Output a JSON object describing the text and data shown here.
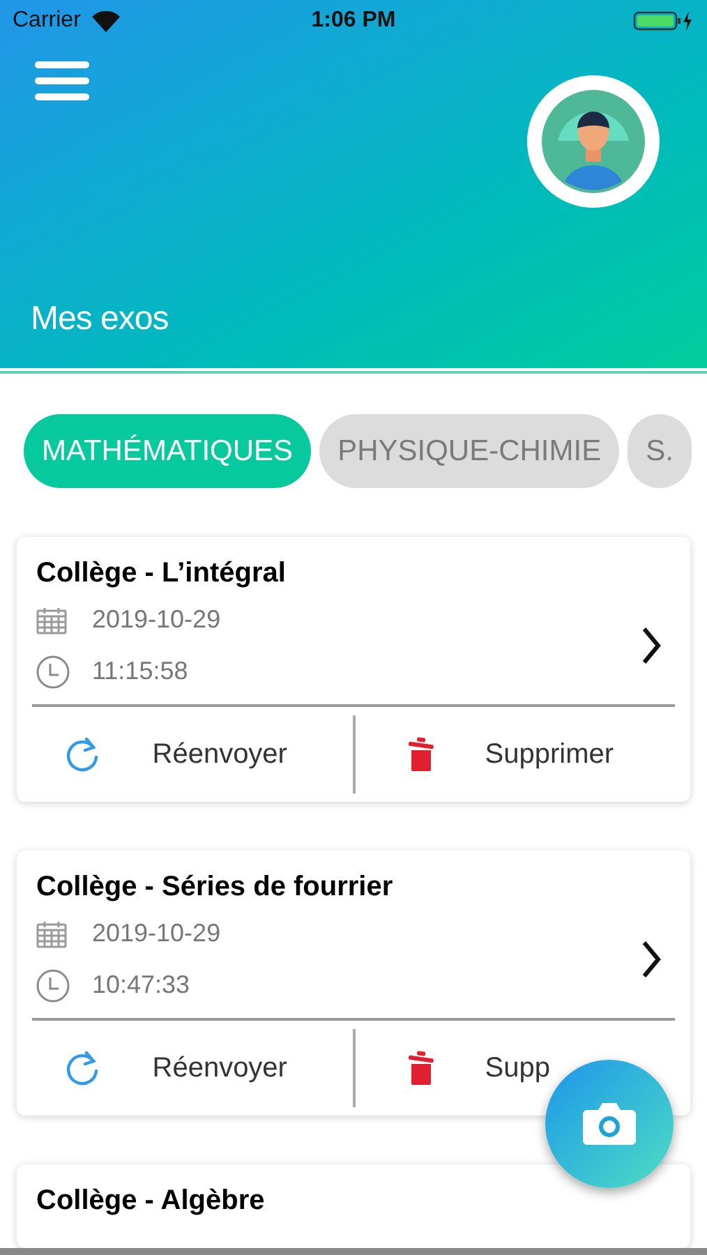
{
  "status_bar": {
    "carrier": "Carrier",
    "time": "1:06 PM"
  },
  "header": {
    "title": "Mes exos"
  },
  "tabs": [
    {
      "label": "MATHÉMATIQUES",
      "selected": true
    },
    {
      "label": "PHYSIQUE-CHIMIE",
      "selected": false
    },
    {
      "label": "S.",
      "selected": false
    }
  ],
  "cards": [
    {
      "title": "Collège - L’intégral",
      "date": "2019-10-29",
      "time": "11:15:58",
      "actions": [
        {
          "kind": "resend",
          "label": "Réenvoyer"
        },
        {
          "kind": "delete",
          "label": "Supprimer"
        }
      ]
    },
    {
      "title": "Collège - Séries de fourrier",
      "date": "2019-10-29",
      "time": "10:47:33",
      "actions": [
        {
          "kind": "resend",
          "label": "Réenvoyer"
        },
        {
          "kind": "delete",
          "label": "Supp"
        }
      ]
    },
    {
      "title": "Collège - Algèbre"
    }
  ]
}
